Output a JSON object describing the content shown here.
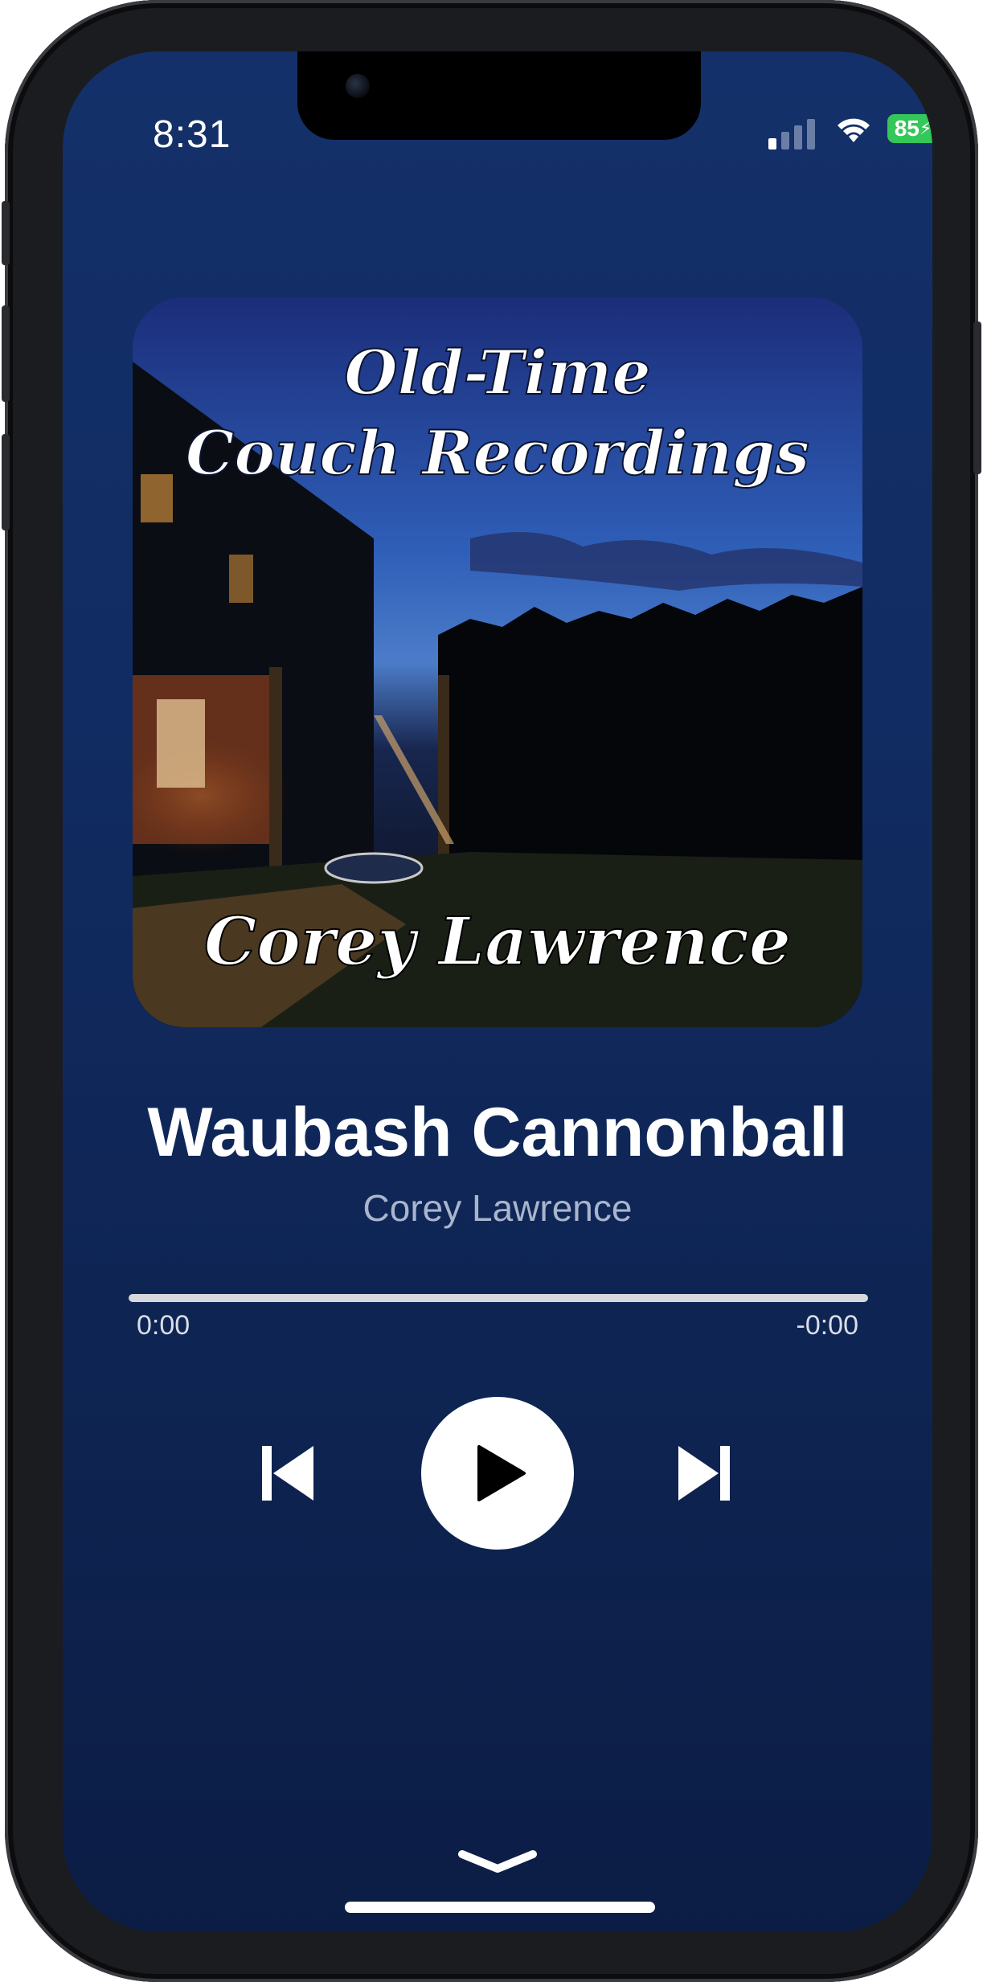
{
  "status_bar": {
    "time": "8:31",
    "battery_level": "85",
    "battery_charging": true,
    "cellular_bars_active": 1,
    "cellular_bars_total": 4,
    "icons": [
      "cellular-signal-icon",
      "wifi-icon",
      "battery-charging-icon"
    ]
  },
  "album_art": {
    "title_line1": "Old-Time",
    "title_line2": "Couch Recordings",
    "artist": "Corey Lawrence"
  },
  "now_playing": {
    "title": "Waubash Cannonball",
    "artist": "Corey Lawrence"
  },
  "progress": {
    "elapsed": "0:00",
    "remaining": "-0:00",
    "fraction": 0.0
  },
  "controls": {
    "previous": "skip-back-icon",
    "play": "play-icon",
    "next": "skip-forward-icon",
    "collapse": "chevron-down-icon"
  },
  "colors": {
    "background_top": "#14306a",
    "background_bottom": "#0c1d45",
    "accent": "#ffffff",
    "secondary_text": "#a9b5cc",
    "battery": "#34c759"
  }
}
